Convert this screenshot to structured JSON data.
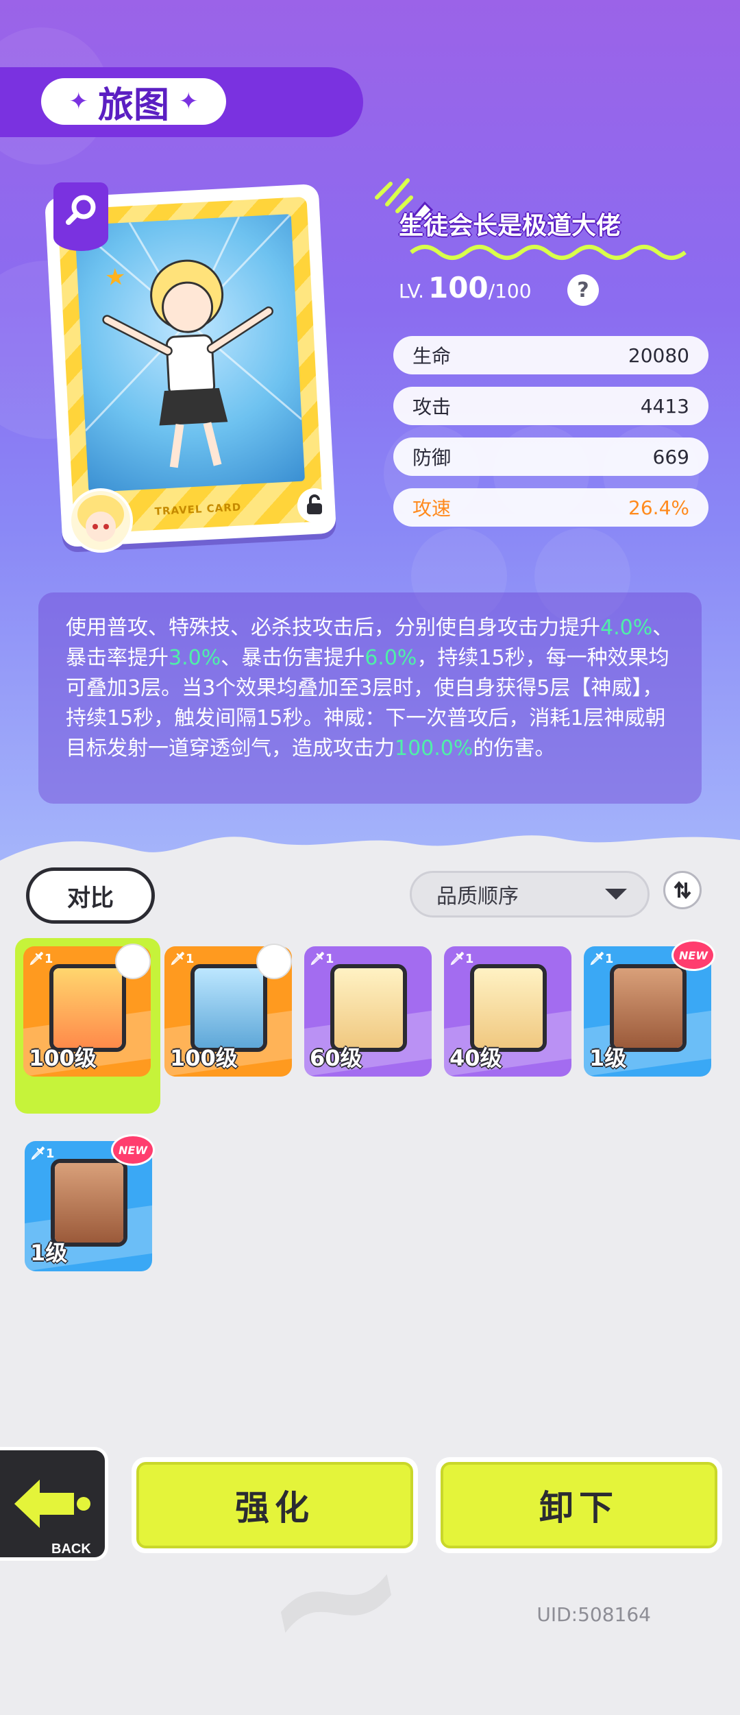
{
  "header": {
    "title": "旅图"
  },
  "card": {
    "label": "TRAVEL CARD"
  },
  "character": {
    "name": "生徒会长是极道大佬",
    "level_prefix": "LV.",
    "level_current": "100",
    "level_max": "/100",
    "help": "?"
  },
  "stats": [
    {
      "label": "生命",
      "value": "20080"
    },
    {
      "label": "攻击",
      "value": "4413"
    },
    {
      "label": "防御",
      "value": "669"
    },
    {
      "label": "攻速",
      "value": "26.4%"
    }
  ],
  "description": {
    "segments": [
      "使用普攻、特殊技、必杀技攻击后，分别使自身攻击力提升",
      "4.0%",
      "、暴击率提升",
      "3.0%",
      "、暴击伤害提升",
      "6.0%",
      "，持续15秒，每一种效果均可叠加3层。当3个效果均叠加至3层时，使自身获得5层【神威】，持续15秒，触发间隔15秒。神威：下一次普攻后，消耗1层神威朝目标发射一道穿透剑气，造成攻击力",
      "100.0%",
      "的伤害。"
    ]
  },
  "controls": {
    "compare": "对比",
    "sort_selected": "品质顺序"
  },
  "inventory": [
    {
      "count": "1",
      "level": "100级",
      "new": ""
    },
    {
      "count": "1",
      "level": "100级",
      "new": ""
    },
    {
      "count": "1",
      "level": "60级",
      "new": ""
    },
    {
      "count": "1",
      "level": "40级",
      "new": ""
    },
    {
      "count": "1",
      "level": "1级",
      "new": "NEW"
    },
    {
      "count": "1",
      "level": "1级",
      "new": "NEW"
    }
  ],
  "actions": {
    "back": "BACK",
    "enhance": "强化",
    "unequip": "卸下"
  },
  "footer": {
    "uid": "UID:508164"
  },
  "colors": {
    "accent": "#7a32e0",
    "highlight": "#4ff0a8",
    "button": "#e4f43a",
    "orange": "#ff8a1d"
  }
}
